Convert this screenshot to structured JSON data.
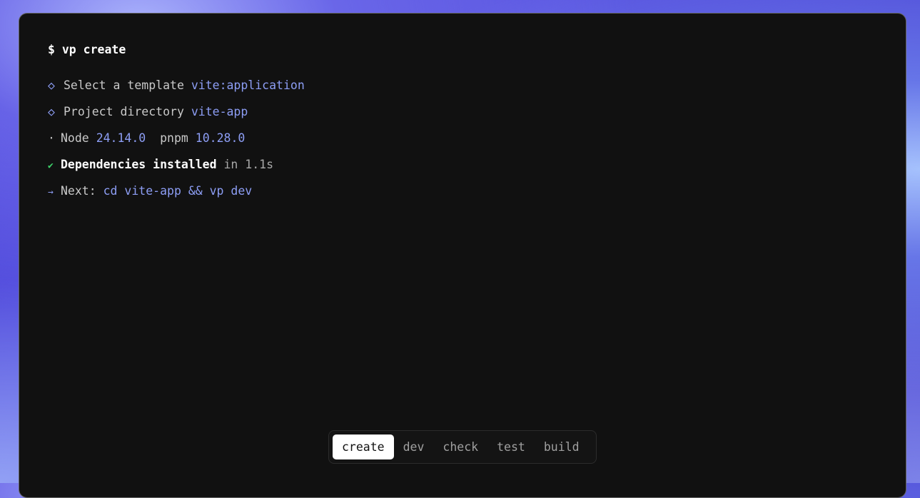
{
  "terminal": {
    "prompt_symbol": "$",
    "command": "vp create",
    "lines": [
      {
        "icon": "◇",
        "icon_name": "diamond-icon",
        "label": "Select a template",
        "value": "vite:application"
      },
      {
        "icon": "◇",
        "icon_name": "diamond-icon",
        "label": "Project directory",
        "value": "vite-app"
      },
      {
        "icon": "·",
        "icon_name": "dot-icon",
        "label": "Node",
        "value": "24.14.0",
        "label2": "pnpm",
        "value2": "10.28.0"
      },
      {
        "icon": "✔",
        "icon_name": "check-icon",
        "label": "Dependencies installed",
        "value": "in 1.1s"
      },
      {
        "icon": "→",
        "icon_name": "arrow-right-icon",
        "label": "Next:",
        "value": "cd vite-app && vp dev"
      }
    ]
  },
  "tabs": [
    {
      "label": "create",
      "active": true
    },
    {
      "label": "dev",
      "active": false
    },
    {
      "label": "check",
      "active": false
    },
    {
      "label": "test",
      "active": false
    },
    {
      "label": "build",
      "active": false
    }
  ],
  "colors": {
    "accent": "#8d9ef5",
    "success": "#3ed36b",
    "terminal_bg": "#111111"
  }
}
